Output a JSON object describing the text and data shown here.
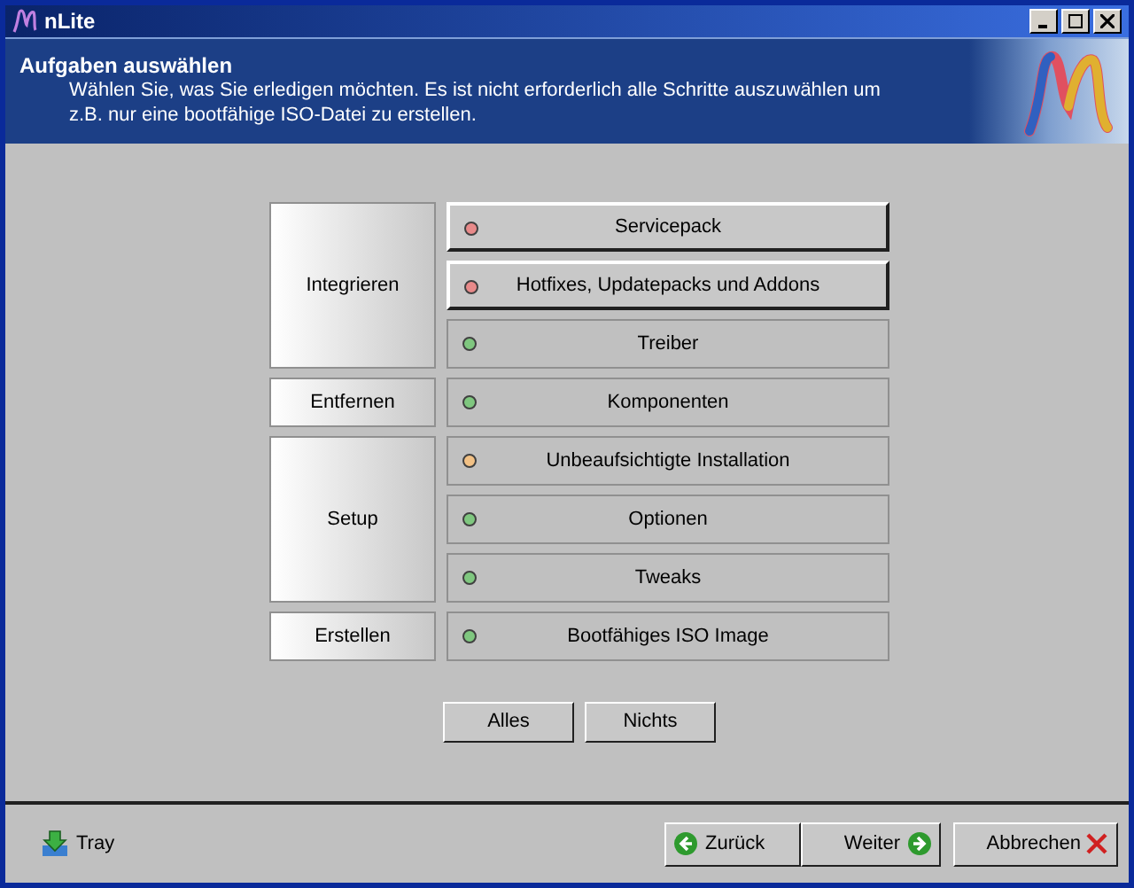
{
  "window": {
    "title": "nLite"
  },
  "header": {
    "title": "Aufgaben auswählen",
    "description": "Wählen Sie, was Sie erledigen möchten. Es ist nicht erforderlich alle Schritte auszuwählen um z.B. nur eine bootfähige ISO-Datei zu erstellen."
  },
  "groups": [
    {
      "label": "Integrieren",
      "tasks": [
        {
          "label": "Servicepack",
          "selected": true,
          "color": "#e88a8a"
        },
        {
          "label": "Hotfixes, Updatepacks und Addons",
          "selected": true,
          "color": "#e88a8a"
        },
        {
          "label": "Treiber",
          "selected": false,
          "color": "#7fc77f"
        }
      ]
    },
    {
      "label": "Entfernen",
      "tasks": [
        {
          "label": "Komponenten",
          "selected": false,
          "color": "#7fc77f"
        }
      ]
    },
    {
      "label": "Setup",
      "tasks": [
        {
          "label": "Unbeaufsichtigte Installation",
          "selected": false,
          "color": "#f2c185"
        },
        {
          "label": "Optionen",
          "selected": false,
          "color": "#7fc77f"
        },
        {
          "label": "Tweaks",
          "selected": false,
          "color": "#7fc77f"
        }
      ]
    },
    {
      "label": "Erstellen",
      "tasks": [
        {
          "label": "Bootfähiges ISO Image",
          "selected": false,
          "color": "#7fc77f"
        }
      ]
    }
  ],
  "select_buttons": [
    "Alles",
    "Nichts"
  ],
  "footer": {
    "tray": "Tray",
    "back": "Zurück",
    "next": "Weiter",
    "cancel": "Abbrechen"
  }
}
